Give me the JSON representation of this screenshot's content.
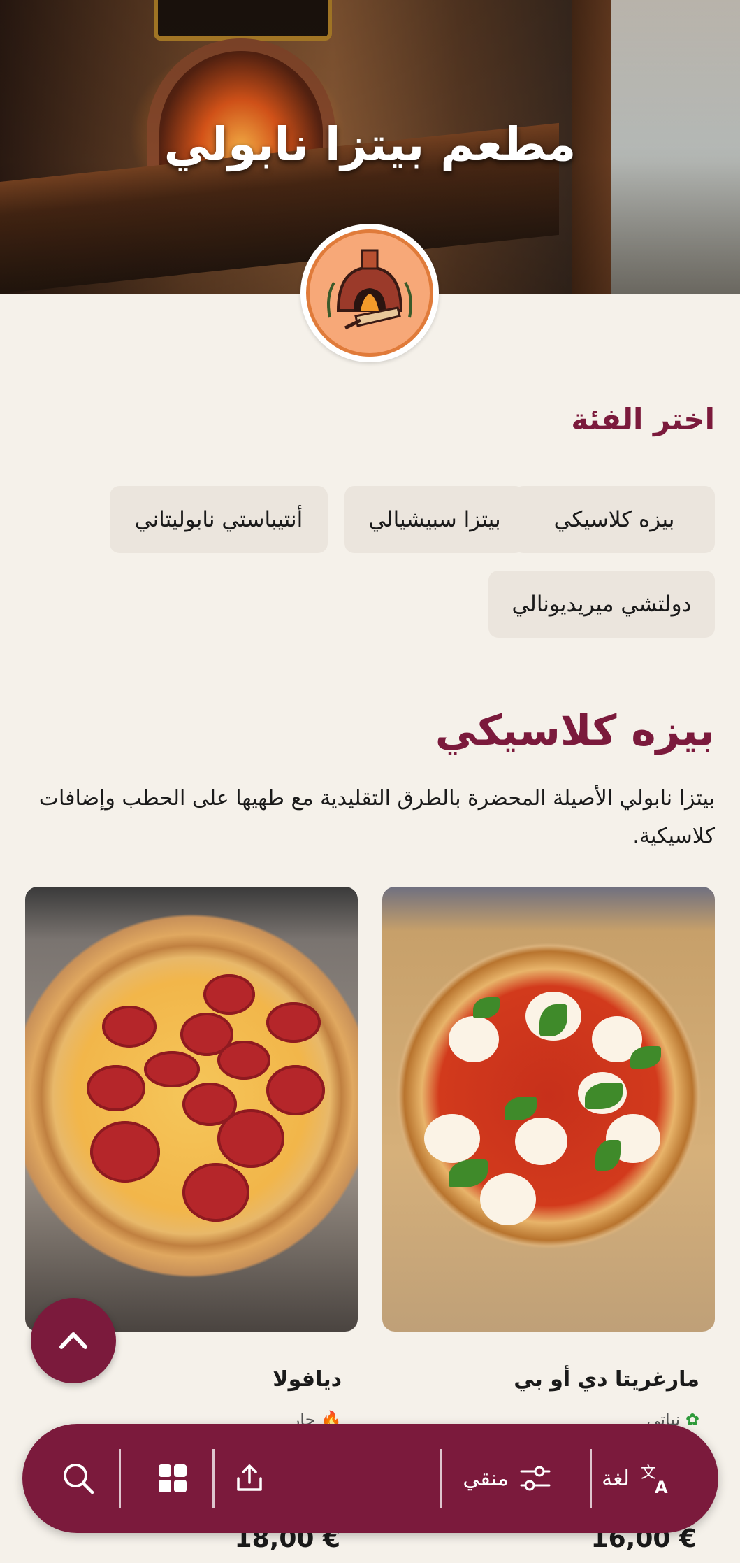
{
  "hero": {
    "title": "مطعم بيتزا نابولي"
  },
  "categories": {
    "heading": "اختر الفئة",
    "chips": [
      "بيزه كلاسيكي",
      "بيتزا سبيشيالي",
      "أنتيباستي نابوليتاني",
      "دولتشي ميريديونالي"
    ]
  },
  "section": {
    "title": "بيزه كلاسيكي",
    "description": "بيتزا نابولي الأصيلة المحضرة بالطرق التقليدية مع طهيها على الحطب وإضافات كلاسيكية."
  },
  "products": [
    {
      "name": "مارغريتا دي أو بي",
      "tag": "نباتي",
      "price": "16,00 €"
    },
    {
      "name": "ديافولا",
      "tag": "حار",
      "price": "18,00 €"
    }
  ],
  "bottom_bar": {
    "language_label": "لغة",
    "filter_label": "منقي"
  },
  "colors": {
    "accent": "#7b1a3c",
    "background": "#f5f1ea",
    "chip": "#ebe5dd"
  }
}
